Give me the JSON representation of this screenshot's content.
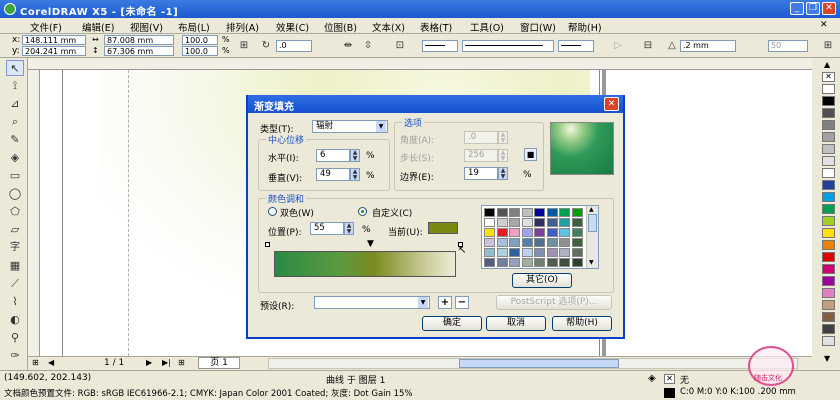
{
  "window": {
    "title": "CorelDRAW X5 - [未命名 -1]"
  },
  "menu": [
    "文件(F)",
    "编辑(E)",
    "视图(V)",
    "布局(L)",
    "排列(A)",
    "效果(C)",
    "位图(B)",
    "文本(X)",
    "表格(T)",
    "工具(O)",
    "窗口(W)",
    "帮助(H)"
  ],
  "propbar": {
    "x": "148.111 mm",
    "y": "204.241 mm",
    "w": "87.008 mm",
    "h": "67.306 mm",
    "scale_x": "100.0",
    "scale_y": "100.0",
    "pct": "%",
    "rotation": ".0",
    "outline": ".2 mm",
    "opacity": "50"
  },
  "dialog": {
    "title": "渐变填充",
    "type_label": "类型(T):",
    "type_value": "辐射",
    "center_group": "中心位移",
    "horizontal_label": "水平(I):",
    "horizontal_value": "6",
    "vertical_label": "垂直(V):",
    "vertical_value": "49",
    "options_group": "选项",
    "angle_label": "角度(A):",
    "angle_value": ".0",
    "steps_label": "步长(S):",
    "steps_value": "256",
    "edge_label": "边界(E):",
    "edge_value": "19",
    "pct": "%",
    "color_group": "颜色调和",
    "two_color": "双色(W)",
    "custom": "自定义(C)",
    "position_label": "位置(P):",
    "position_value": "55",
    "current_label": "当前(U):",
    "current_color": "#7a8a10",
    "other_button": "其它(O)",
    "presets_label": "预设(R):",
    "postscript_button": "PostScript 选项(P)...",
    "ok": "确定",
    "cancel": "取消",
    "help": "帮助(H)",
    "palette_colors": [
      "#000000",
      "#555555",
      "#808080",
      "#c0c0c0",
      "#0000a0",
      "#005aa0",
      "#00a050",
      "#00a000",
      "#ffffff",
      "#d0d0d0",
      "#a8a8a8",
      "#e0e0e0",
      "#303060",
      "#406090",
      "#20a0a0",
      "#3a6040",
      "#ffe000",
      "#e02020",
      "#f0a0c0",
      "#a0a0ff",
      "#8040a0",
      "#4060c0",
      "#60c0e0",
      "#408060",
      "#d0c0e0",
      "#a8c0e0",
      "#80a0c0",
      "#5080b0",
      "#507090",
      "#7090a0",
      "#909090",
      "#406040",
      "#90c0d0",
      "#b0d0e0",
      "#3060a0",
      "#c0d0f0",
      "#8090b0",
      "#a090b0",
      "#b0b0c0",
      "#607060",
      "#506080",
      "#7080a0",
      "#90a0c0",
      "#a0b0a0",
      "#708070",
      "#506050",
      "#405040",
      "#304030"
    ]
  },
  "page": {
    "counter": "1 / 1",
    "tab": "页 1"
  },
  "status": {
    "coords": "(149.602, 202.143)",
    "object": "曲线 于 图层 1",
    "profile": "文档颜色预置文件: RGB: sRGB IEC61966-2.1; CMYK: Japan Color 2001 Coated; 灰度: Dot Gain 15%",
    "fill": "无",
    "outline": "C:0 M:0 Y:0 K:100 .200 mm"
  },
  "palette": [
    "#ffffff",
    "#000000",
    "#505050",
    "#808080",
    "#a0a0a0",
    "#c0c0c0",
    "#e0e0e0",
    "#ffffff",
    "#20409c",
    "#00a0e0",
    "#00a050",
    "#a0d020",
    "#ffe000",
    "#f08000",
    "#e00000",
    "#d00070",
    "#a000a0",
    "#e080c0",
    "#c0a080",
    "#806040",
    "#404040",
    "#e0e0e0"
  ],
  "watermark": "随击文化"
}
